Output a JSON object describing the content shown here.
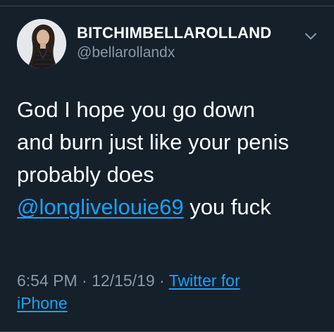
{
  "tweet": {
    "display_name": "BITCHIMBELLAROLLAND",
    "handle": "@bellarollandx",
    "text_lines": [
      "God I hope you go down",
      "and burn just like your penis",
      "probably does"
    ],
    "mention": "@longlivelouie69",
    "text_after_mention": " you fuck",
    "time": "6:54 PM",
    "separator": " · ",
    "date": "12/15/19",
    "source_line1": "Twitter for",
    "source_line2": "iPhone"
  },
  "icons": {
    "avatar": "profile-photo",
    "menu": "chevron-down-icon"
  },
  "colors": {
    "background": "#15202b",
    "text": "#ffffff",
    "secondary": "#8899a6",
    "link": "#1da1f2",
    "divider": "#38444d"
  }
}
